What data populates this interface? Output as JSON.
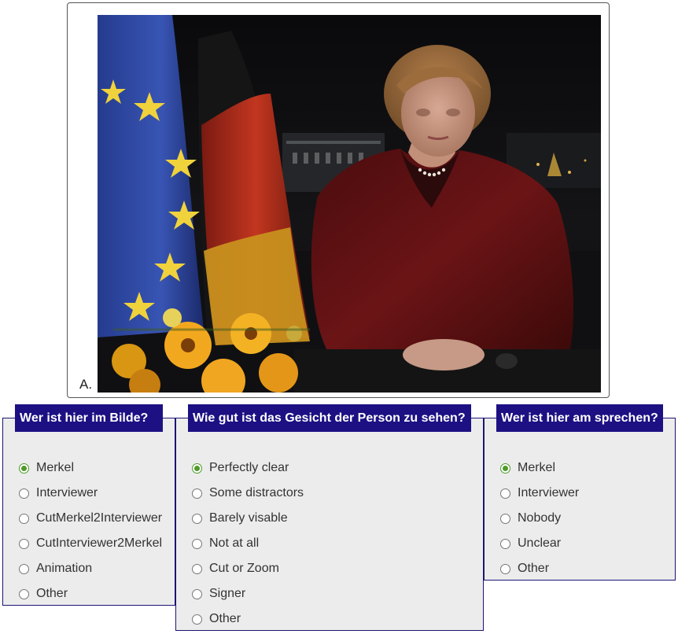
{
  "video": {
    "label": "A."
  },
  "questions": [
    {
      "title": "Wer ist hier im Bilde?",
      "options": [
        "Merkel",
        "Interviewer",
        "CutMerkel2Interviewer",
        "CutInterviewer2Merkel",
        "Animation",
        "Other"
      ],
      "selected": 0
    },
    {
      "title": "Wie gut ist das Gesicht der Person zu sehen?",
      "options": [
        "Perfectly clear",
        "Some distractors",
        "Barely visable",
        "Not at all",
        "Cut or Zoom",
        "Signer",
        "Other"
      ],
      "selected": 0
    },
    {
      "title": "Wer ist hier am sprechen?",
      "options": [
        "Merkel",
        "Interviewer",
        "Nobody",
        "Unclear",
        "Other"
      ],
      "selected": 0
    }
  ],
  "colors": {
    "title_bg": "#1c1083",
    "panel_bg": "#ececec",
    "radio_checked": "#4f9a2b"
  }
}
